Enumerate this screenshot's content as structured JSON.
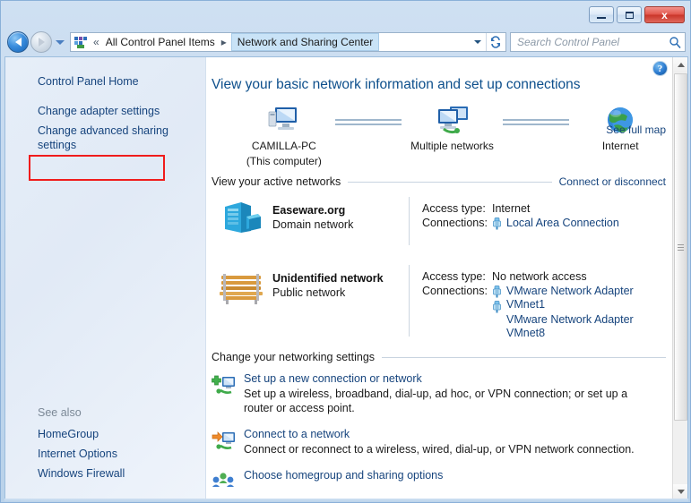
{
  "window": {
    "minimize_label": "Minimize",
    "maximize_label": "Maximize",
    "close_label": "x"
  },
  "addressbar": {
    "back_label": "Back",
    "forward_label": "Forward",
    "history_label": "Recent pages",
    "crumb_root": "All Control Panel Items",
    "crumb_current": "Network and Sharing Center",
    "separator": "▸",
    "double_chevron": "«",
    "refresh_label": "Refresh",
    "search_placeholder": "Search Control Panel",
    "search_value": ""
  },
  "sidebar": {
    "items": [
      {
        "label": "Control Panel Home",
        "name": "control-panel-home"
      },
      {
        "label": "Change adapter settings",
        "name": "change-adapter-settings"
      },
      {
        "label": "Change advanced sharing settings",
        "name": "change-advanced-sharing-settings"
      }
    ],
    "see_also_title": "See also",
    "see_also": [
      {
        "label": "HomeGroup",
        "name": "homegroup"
      },
      {
        "label": "Internet Options",
        "name": "internet-options"
      },
      {
        "label": "Windows Firewall",
        "name": "windows-firewall"
      }
    ],
    "highlight_color": "#f01c1c",
    "highlight_target": "Change adapter settings"
  },
  "content": {
    "help_label": "?",
    "page_title": "View your basic network information and set up connections",
    "see_full_map": "See full map",
    "network_map": {
      "nodes": [
        {
          "label": "CAMILLA-PC",
          "sublabel": "(This computer)",
          "icon": "computer-icon"
        },
        {
          "label": "Multiple networks",
          "sublabel": "",
          "icon": "multiple-networks-icon"
        },
        {
          "label": "Internet",
          "sublabel": "",
          "icon": "globe-icon"
        }
      ]
    },
    "active_networks": {
      "heading": "View your active networks",
      "action": "Connect or disconnect",
      "networks": [
        {
          "name": "Easeware.org",
          "type": "Domain network",
          "icon": "server-icon",
          "access_type_label": "Access type:",
          "access_type_value": "Internet",
          "connections_label": "Connections:",
          "connections": [
            "Local Area Connection"
          ]
        },
        {
          "name": "Unidentified network",
          "type": "Public network",
          "icon": "bench-icon",
          "access_type_label": "Access type:",
          "access_type_value": "No network access",
          "connections_label": "Connections:",
          "connections": [
            "VMware Network Adapter VMnet1",
            "VMware Network Adapter VMnet8"
          ]
        }
      ]
    },
    "networking_settings": {
      "heading": "Change your networking settings",
      "items": [
        {
          "title": "Set up a new connection or network",
          "desc": "Set up a wireless, broadband, dial-up, ad hoc, or VPN connection; or set up a router or access point.",
          "icon": "new-connection-icon"
        },
        {
          "title": "Connect to a network",
          "desc": "Connect or reconnect to a wireless, wired, dial-up, or VPN network connection.",
          "icon": "connect-network-icon"
        },
        {
          "title": "Choose homegroup and sharing options",
          "desc": "",
          "icon": "homegroup-icon"
        }
      ]
    },
    "scrollbar": {
      "up_label": "Scroll up",
      "down_label": "Scroll down"
    }
  }
}
